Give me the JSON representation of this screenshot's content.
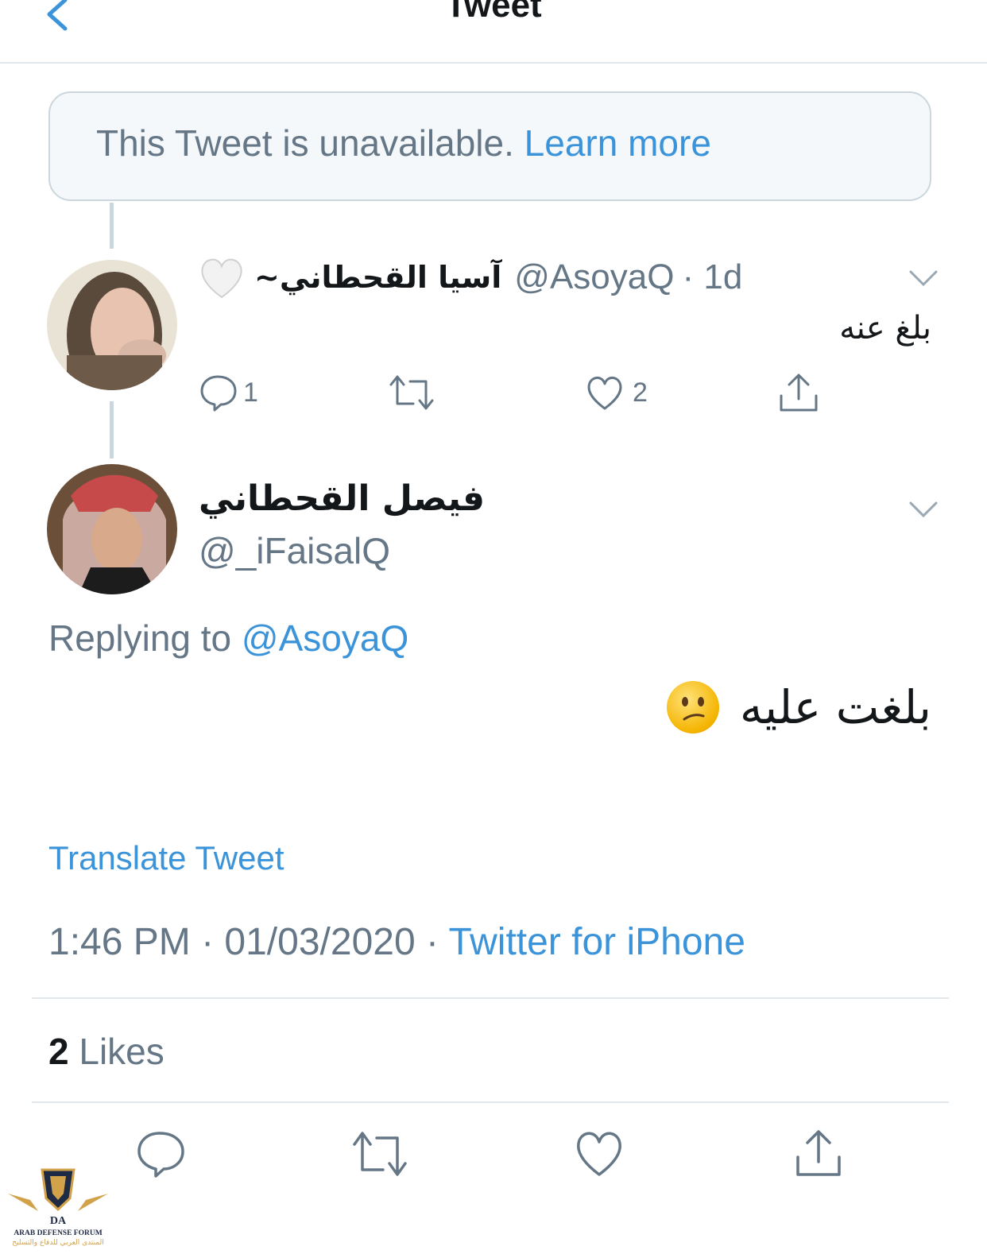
{
  "header": {
    "title": "Tweet"
  },
  "unavailable": {
    "text": "This Tweet is unavailable.",
    "link": "Learn more"
  },
  "parent_tweet": {
    "display_name": "آسيا القحطاني~",
    "handle": "@AsoyaQ",
    "time": "· 1d",
    "body": "بلغ عنه",
    "reply_count": "1",
    "like_count": "2"
  },
  "main_tweet": {
    "display_name": "فيصل القحطاني",
    "handle": "@_iFaisalQ",
    "replying_prefix": "Replying to",
    "replying_handle": "@AsoyaQ",
    "body": "بلغت عليه",
    "translate": "Translate Tweet",
    "timestamp": "1:46 PM · 01/03/2020 · ",
    "source": "Twitter for iPhone",
    "likes_count": "2",
    "likes_label": "Likes"
  },
  "watermark": {
    "line1": "ARAB DEFENSE FORUM",
    "line2": "المنتدى العربي للدفاع والتسليح"
  },
  "colors": {
    "accent": "#3b94d9",
    "muted": "#657786",
    "divider": "#e1e8ed"
  }
}
